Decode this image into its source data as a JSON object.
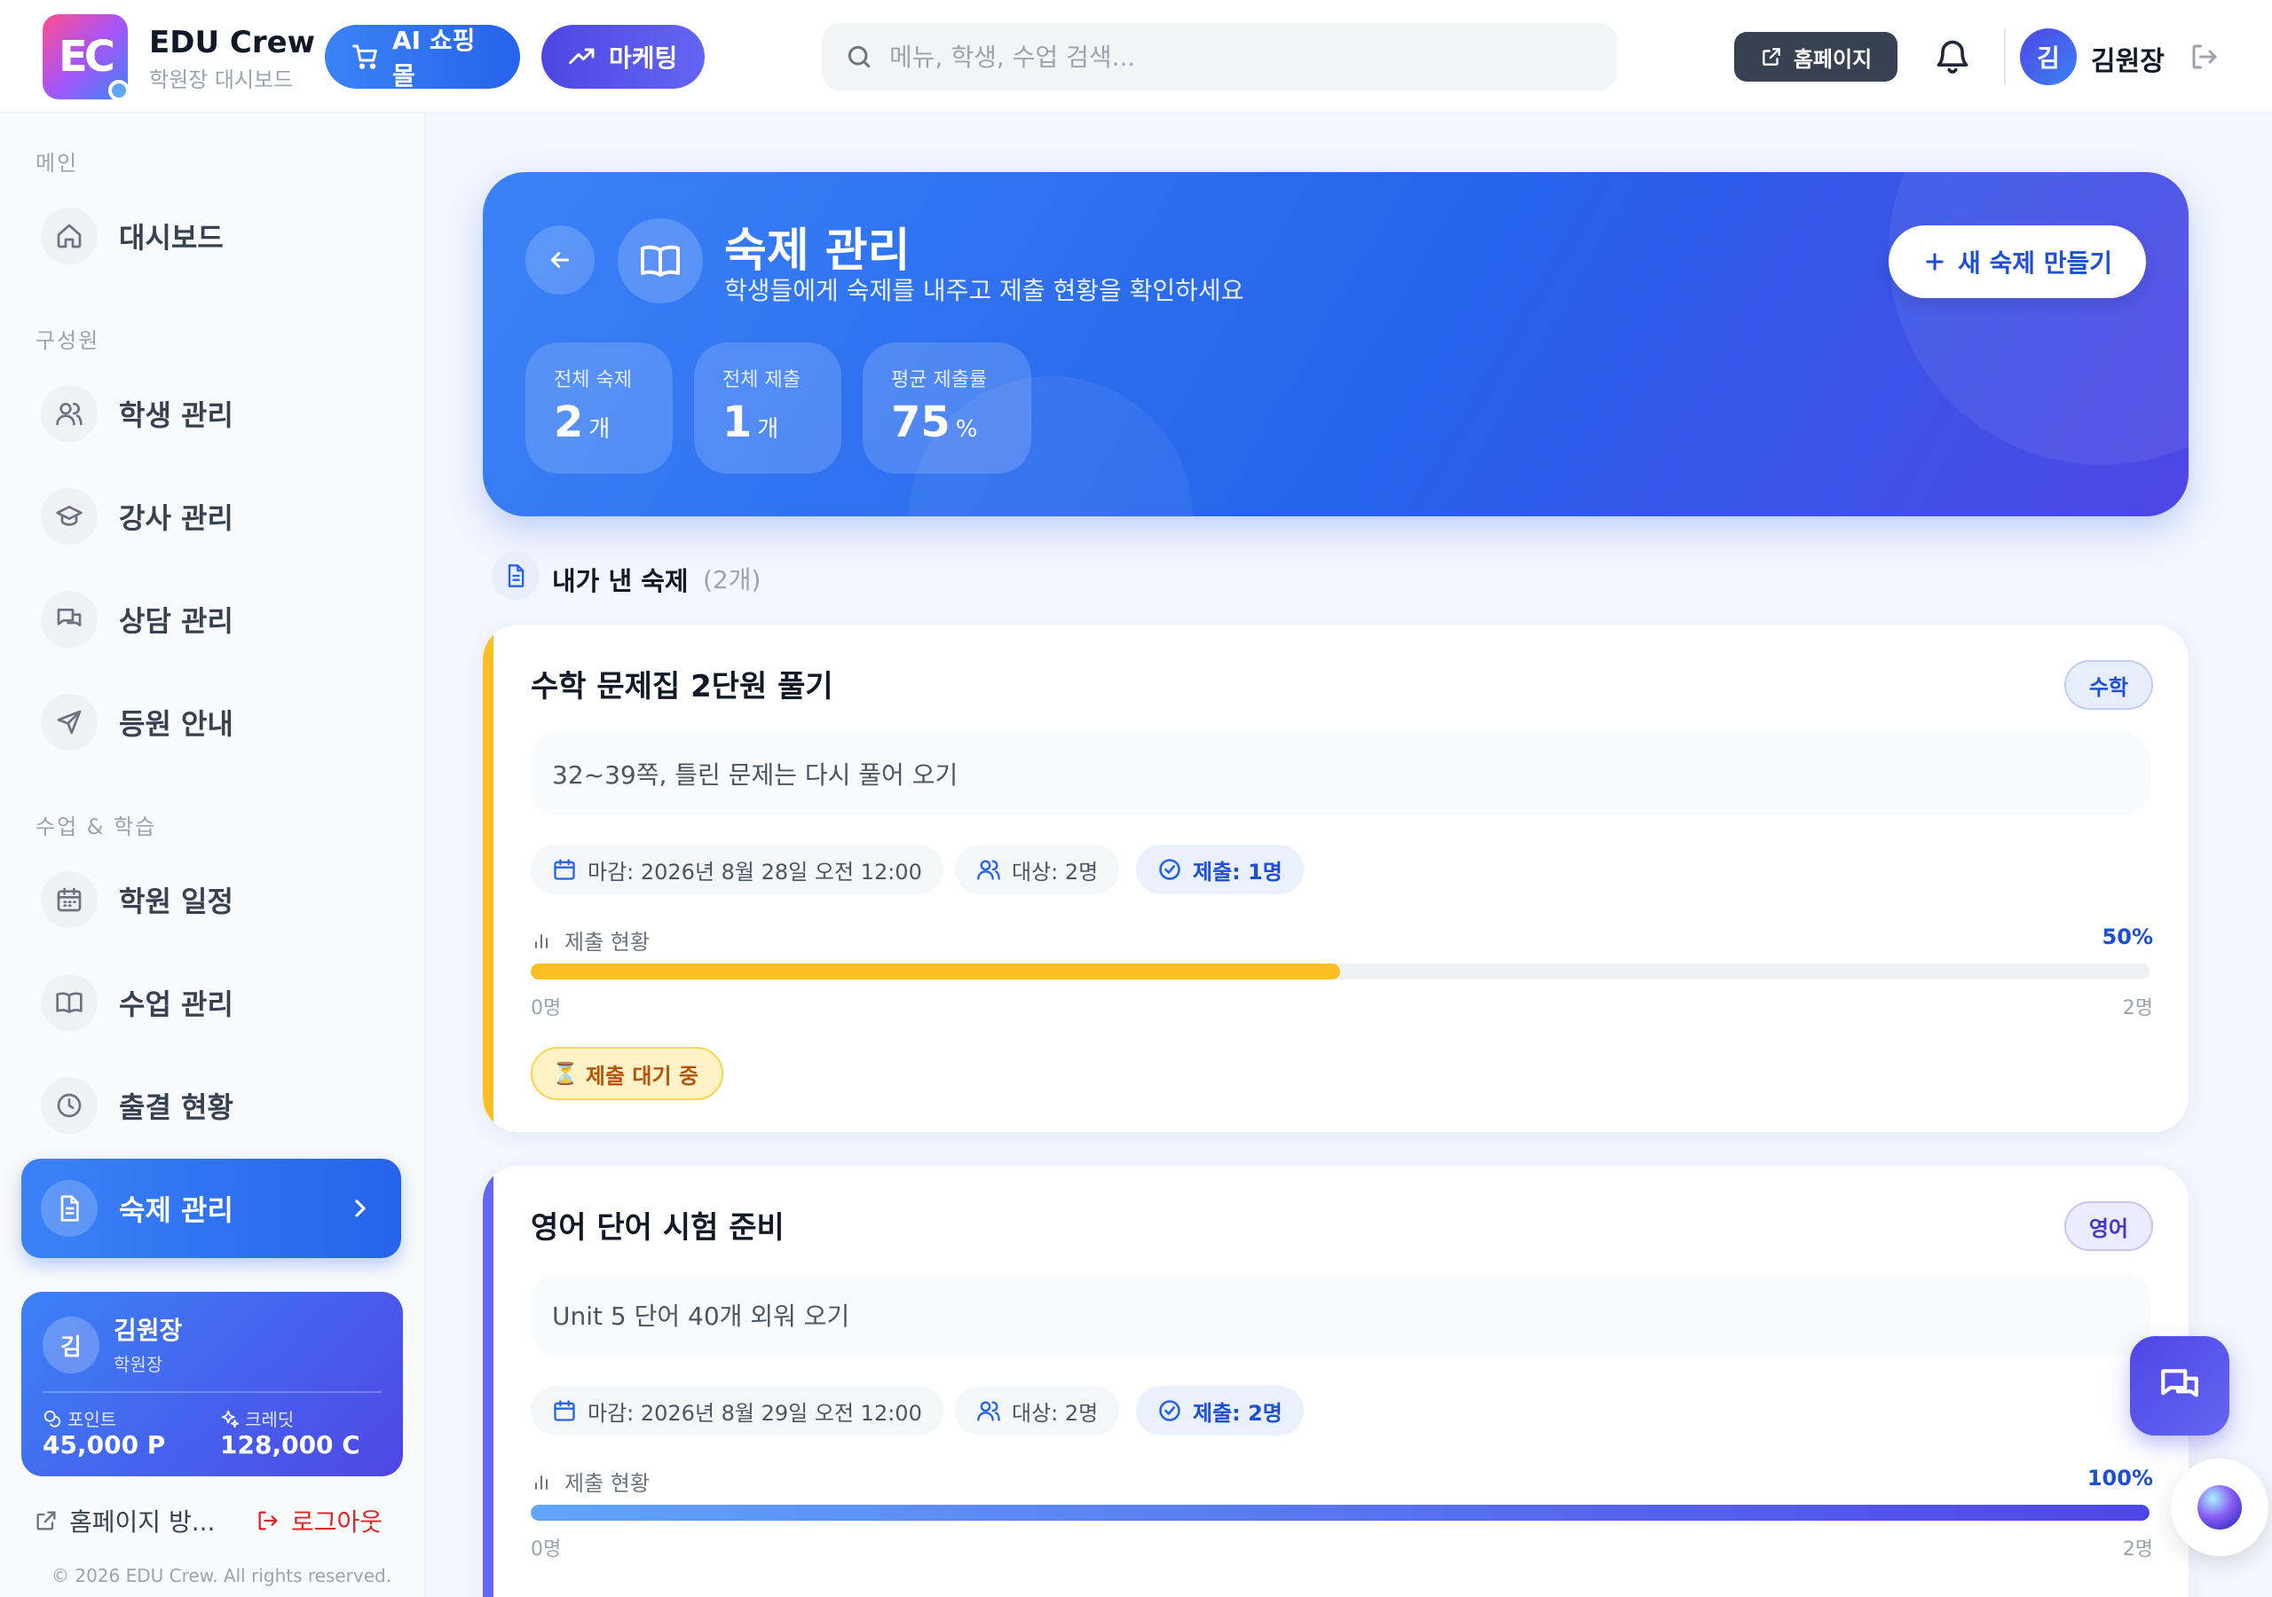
{
  "header": {
    "logo_text": "EC",
    "brand_name": "EDU Crew",
    "brand_sub": "학원장 대시보드",
    "shop_label": "AI 쇼핑몰",
    "marketing_label": "마케팅",
    "search_placeholder": "메뉴, 학생, 수업 검색...",
    "homepage_label": "홈페이지",
    "user_initial": "김",
    "user_name": "김원장"
  },
  "sidebar": {
    "sections": {
      "main": "메인",
      "members": "구성원",
      "classes": "수업 & 학습"
    },
    "items": [
      {
        "label": "대시보드",
        "icon": "home-icon"
      },
      {
        "label": "학생 관리",
        "icon": "users-icon"
      },
      {
        "label": "강사 관리",
        "icon": "graduation-cap-icon"
      },
      {
        "label": "상담 관리",
        "icon": "chat-icon"
      },
      {
        "label": "등원 안내",
        "icon": "send-icon"
      },
      {
        "label": "학원 일정",
        "icon": "calendar-icon"
      },
      {
        "label": "수업 관리",
        "icon": "book-icon"
      },
      {
        "label": "출결 현황",
        "icon": "clock-icon"
      },
      {
        "label": "숙제 관리",
        "icon": "document-icon",
        "active": true
      }
    ],
    "user_card": {
      "initial": "김",
      "name": "김원장",
      "role": "학원장",
      "points_label": "포인트",
      "points_value": "45,000 P",
      "credits_label": "크레딧",
      "credits_value": "128,000 C"
    },
    "footer": {
      "homepage_link": "홈페이지 방...",
      "logout": "로그아웃",
      "copyright": "© 2026 EDU Crew. All rights reserved."
    }
  },
  "hero": {
    "title": "숙제 관리",
    "subtitle": "학생들에게 숙제를 내주고 제출 현황을 확인하세요",
    "new_button": "새 숙제 만들기",
    "stats": [
      {
        "label": "전체 숙제",
        "value": "2",
        "unit": "개"
      },
      {
        "label": "전체 제출",
        "value": "1",
        "unit": "개"
      },
      {
        "label": "평균 제출률",
        "value": "75",
        "unit": "%"
      }
    ]
  },
  "list": {
    "title": "내가 낸 숙제",
    "count": "(2개)"
  },
  "homeworks": [
    {
      "title": "수학 문제집 2단원 풀기",
      "subject": "수학",
      "description": "32~39쪽, 틀린 문제는 다시 풀어 오기",
      "deadline": "마감: 2026년 8월 28일 오전 12:00",
      "target": "대상: 2명",
      "submitted": "제출: 1명",
      "progress_label": "제출 현황",
      "progress_percent": "50%",
      "progress_value": 0.5,
      "progress_min": "0명",
      "progress_max": "2명",
      "status": "제출 대기 중",
      "accent": "#fbbf24",
      "tag_bg": "#e6eefc",
      "tag_color": "#1d4ed8",
      "status_bg": "#fef3c7",
      "status_color": "#b45309"
    },
    {
      "title": "영어 단어 시험 준비",
      "subject": "영어",
      "description": "Unit 5 단어 40개 외워 오기",
      "deadline": "마감: 2026년 8월 29일 오전 12:00",
      "target": "대상: 2명",
      "submitted": "제출: 2명",
      "progress_label": "제출 현황",
      "progress_percent": "100%",
      "progress_value": 1.0,
      "progress_min": "0명",
      "progress_max": "2명",
      "accent": "#6366f1",
      "tag_bg": "#eceafd",
      "tag_color": "#4338ca"
    }
  ],
  "colors": {
    "primary": "#2563eb",
    "indigo": "#4f46e5"
  }
}
